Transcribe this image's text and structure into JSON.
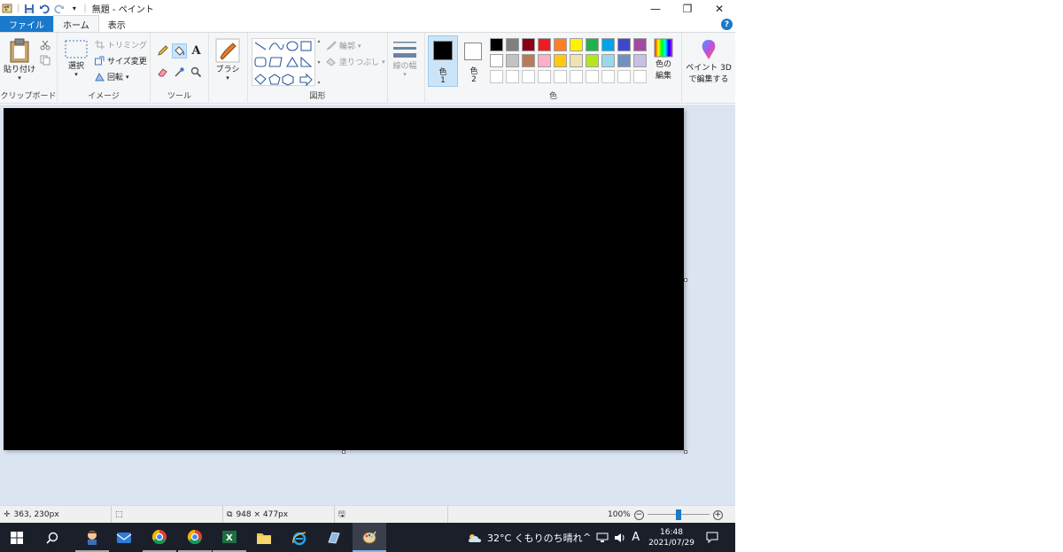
{
  "title_bar": {
    "title": "無題 - ペイント",
    "minimize": "—",
    "restore": "❐",
    "close": "✕"
  },
  "tabs": [
    {
      "label": "ファイル"
    },
    {
      "label": "ホーム"
    },
    {
      "label": "表示"
    }
  ],
  "help": "?",
  "ribbon": {
    "clipboard": {
      "group": "クリップボード",
      "paste": "貼り付け"
    },
    "image": {
      "group": "イメージ",
      "select": "選択",
      "trim": "トリミング",
      "resize": "サイズ変更",
      "rotate": "回転"
    },
    "tools": {
      "group": "ツール"
    },
    "brush": {
      "label": "ブラシ"
    },
    "shapes": {
      "group": "図形",
      "outline": "輪郭",
      "fill": "塗りつぶし"
    },
    "size": {
      "label": "線の幅"
    },
    "colors": {
      "group": "色",
      "color1": "色",
      "color1_num": "1",
      "color2": "色",
      "color2_num": "2",
      "edit": "色の\n編集",
      "edit_line1": "色の",
      "edit_line2": "編集",
      "palette_row1": [
        "#000000",
        "#7f7f7f",
        "#880015",
        "#ed1c24",
        "#ff7f27",
        "#fff200",
        "#22b14c",
        "#00a2e8",
        "#3f48cc",
        "#a349a4"
      ],
      "palette_row2": [
        "#ffffff",
        "#c3c3c3",
        "#b97a57",
        "#ffaec9",
        "#ffc90e",
        "#efe4b0",
        "#b5e61d",
        "#99d9ea",
        "#7092be",
        "#c8bfe7"
      ],
      "color1_value": "#000000",
      "color2_value": "#ffffff"
    },
    "paint3d": {
      "line1": "ペイント 3D",
      "line2": "で編集する"
    }
  },
  "statusbar": {
    "cursor_pos": "363, 230px",
    "image_size": "948 × 477px",
    "zoom": "100%",
    "zoom_level": 0.5
  },
  "taskbar": {
    "weather": "32°C くもりのち晴れ",
    "ime": "A",
    "time": "16:48",
    "date": "2021/07/29"
  }
}
